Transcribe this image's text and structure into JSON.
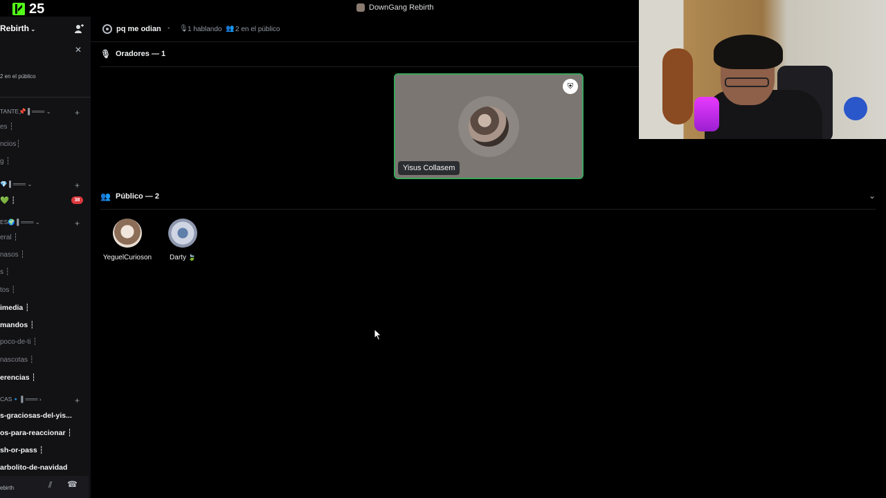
{
  "topbar": {
    "kick_count": "25",
    "window_title": "DownGang Rebirth"
  },
  "sidebar": {
    "server_name": "Rebirth",
    "public_small": "2 en el público",
    "rows": [
      {
        "text": "TANTE📌 ▌═══ ⌄",
        "kind": "cat"
      },
      {
        "text": "es ┆",
        "kind": "normal"
      },
      {
        "text": "ncios┆",
        "kind": "normal"
      },
      {
        "text": "g ┆",
        "kind": "normal"
      },
      {
        "text": "💎 ▌═══ ⌄",
        "kind": "cat"
      },
      {
        "text": "💚 ┆",
        "kind": "bright"
      },
      {
        "text": "ES🌍 ▌═══ ⌄",
        "kind": "cat"
      },
      {
        "text": "eral ┆",
        "kind": "normal"
      },
      {
        "text": "nasos ┆",
        "kind": "normal"
      },
      {
        "text": "s ┆",
        "kind": "normal"
      },
      {
        "text": "tos ┆",
        "kind": "normal"
      },
      {
        "text": "imedia ┆",
        "kind": "bright"
      },
      {
        "text": "mandos ┆",
        "kind": "bright"
      },
      {
        "text": "poco-de-ti ┆",
        "kind": "normal"
      },
      {
        "text": "nascotas ┆",
        "kind": "normal"
      },
      {
        "text": "erencias ┆",
        "kind": "bright"
      },
      {
        "text": "CAS🔹 ▌═══ ›",
        "kind": "cat"
      },
      {
        "text": "s-graciosas-del-yis...",
        "kind": "bright"
      },
      {
        "text": "os-para-reaccionar ┆",
        "kind": "bright"
      },
      {
        "text": "sh-or-pass ┆",
        "kind": "bright"
      },
      {
        "text": "arbolito-de-navidad",
        "kind": "bright"
      }
    ],
    "unread_badge": "38",
    "user_panel_name": "ebirth"
  },
  "stage": {
    "name": "pq me odian",
    "speaking": "1 hablando",
    "audience": "2 en el público",
    "speakers_title": "Oradores — 1",
    "audience_title": "Público — 2",
    "speaker": {
      "name": "Yisus Collasem"
    },
    "audience_members": [
      {
        "name": "YeguelCurioson",
        "suffix": ""
      },
      {
        "name": "Darty",
        "suffix": "🍃"
      }
    ]
  },
  "colors": {
    "speaking_border": "#3ba55c",
    "badge": "#da373c",
    "kick_green": "#53fc18"
  }
}
